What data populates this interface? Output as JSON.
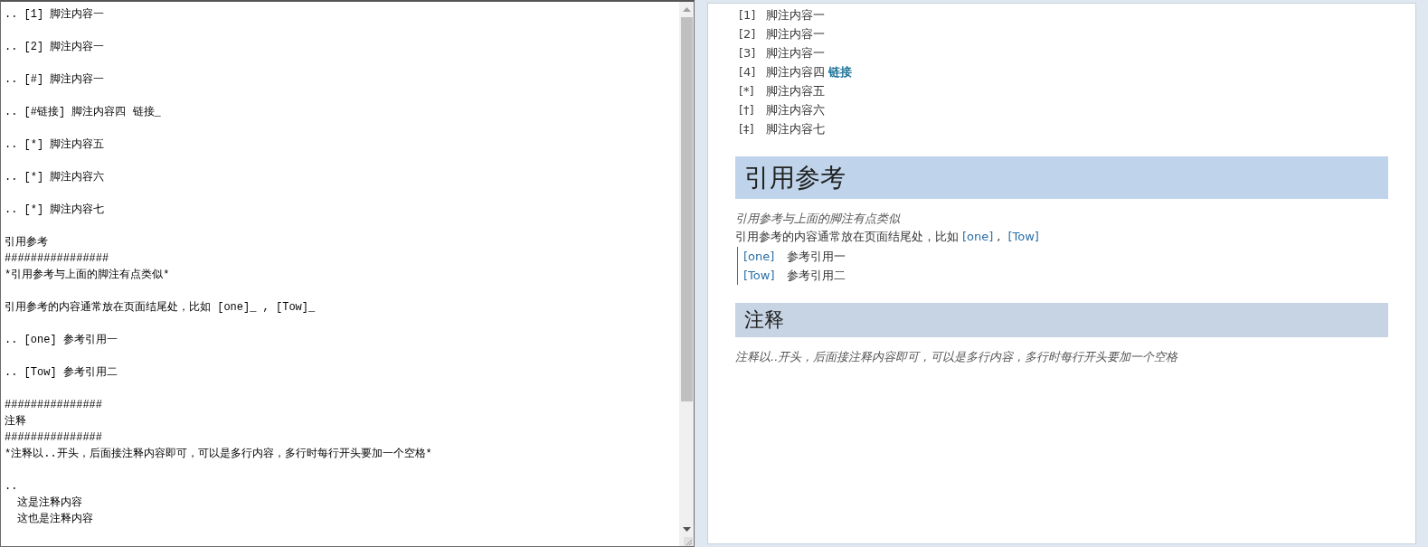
{
  "editor": {
    "blocks": [
      {
        "lines": [
          ".. [1] 脚注内容一"
        ]
      },
      {
        "lines": [
          ".. [2] 脚注内容一"
        ]
      },
      {
        "lines": [
          ".. [#] 脚注内容一"
        ]
      },
      {
        "lines": [
          ".. [#链接] 脚注内容四 链接_"
        ]
      },
      {
        "lines": [
          ".. [*] 脚注内容五"
        ]
      },
      {
        "lines": [
          ".. [*] 脚注内容六"
        ]
      },
      {
        "lines": [
          ".. [*] 脚注内容七"
        ]
      },
      {
        "lines": [
          "引用参考",
          "################",
          "*引用参考与上面的脚注有点类似*"
        ]
      },
      {
        "lines": [
          "引用参考的内容通常放在页面结尾处，比如 [one]_ , [Tow]_"
        ]
      },
      {
        "lines": [
          ".. [one] 参考引用一"
        ]
      },
      {
        "lines": [
          ".. [Tow] 参考引用二"
        ]
      },
      {
        "lines": [
          "###############",
          "注释",
          "###############",
          "*注释以..开头，后面接注释内容即可，可以是多行内容，多行时每行开头要加一个空格*"
        ]
      },
      {
        "lines": [
          "..",
          "  这是注释内容",
          "  这也是注释内容"
        ]
      }
    ]
  },
  "preview": {
    "footnotes": [
      {
        "label": "[1]",
        "text": "脚注内容一"
      },
      {
        "label": "[2]",
        "text": "脚注内容一"
      },
      {
        "label": "[3]",
        "text": "脚注内容一"
      },
      {
        "label": "[4]",
        "text": "脚注内容四",
        "link": "链接"
      },
      {
        "label": "[*]",
        "text": "脚注内容五"
      },
      {
        "label": "[†]",
        "text": "脚注内容六"
      },
      {
        "label": "[‡]",
        "text": "脚注内容七"
      }
    ],
    "sections": [
      {
        "heading": "引用参考",
        "italic": "引用参考与上面的脚注有点类似",
        "paragraph": {
          "text": "引用参考的内容通常放在页面结尾处，比如",
          "links": [
            "[one]",
            "[Tow]"
          ],
          "separator": ","
        },
        "citations": [
          {
            "label": "[one]",
            "text": "参考引用一"
          },
          {
            "label": "[Tow]",
            "text": "参考引用二"
          }
        ]
      },
      {
        "heading": "注释",
        "italic": "注释以..开头，后面接注释内容即可，可以是多行内容，多行时每行开头要加一个空格"
      }
    ]
  }
}
